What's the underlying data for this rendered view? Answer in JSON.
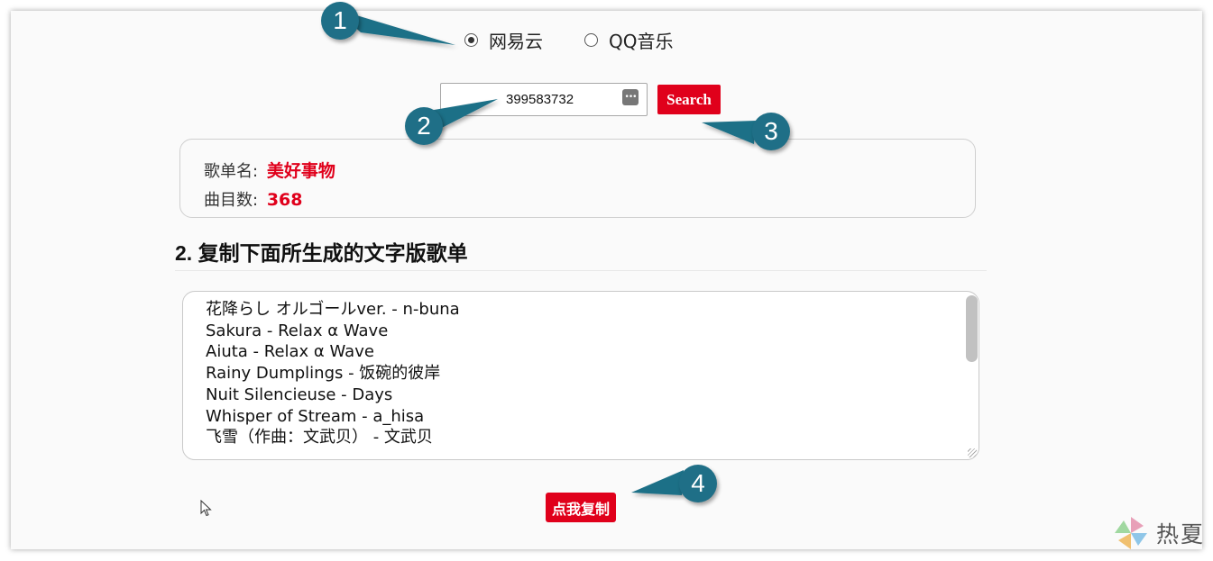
{
  "source": {
    "options": [
      {
        "label": "网易云",
        "checked": true
      },
      {
        "label": "QQ音乐",
        "checked": false
      }
    ]
  },
  "search": {
    "value": "399583732",
    "button_label": "Search"
  },
  "info": {
    "name_label": "歌单名:",
    "name_value": "美好事物",
    "count_label": "曲目数:",
    "count_value": "368"
  },
  "section": {
    "title": "2. 复制下面所生成的文字版歌单"
  },
  "playlist": {
    "lines": [
      "花降らし オルゴールver. - n-buna",
      "Sakura - Relax α Wave",
      "Aiuta - Relax α Wave",
      "Rainy Dumplings - 饭碗的彼岸",
      "Nuit Silencieuse - Days",
      "Whisper of Stream - a_hisa",
      "飞雪（作曲：文武贝） - 文武贝"
    ]
  },
  "copy": {
    "button_label": "点我复制"
  },
  "annotations": {
    "one": "1",
    "two": "2",
    "three": "3",
    "four": "4"
  },
  "watermark": {
    "text": "热夏"
  },
  "colors": {
    "accent": "#e0001b",
    "callout": "#1f6f87"
  }
}
